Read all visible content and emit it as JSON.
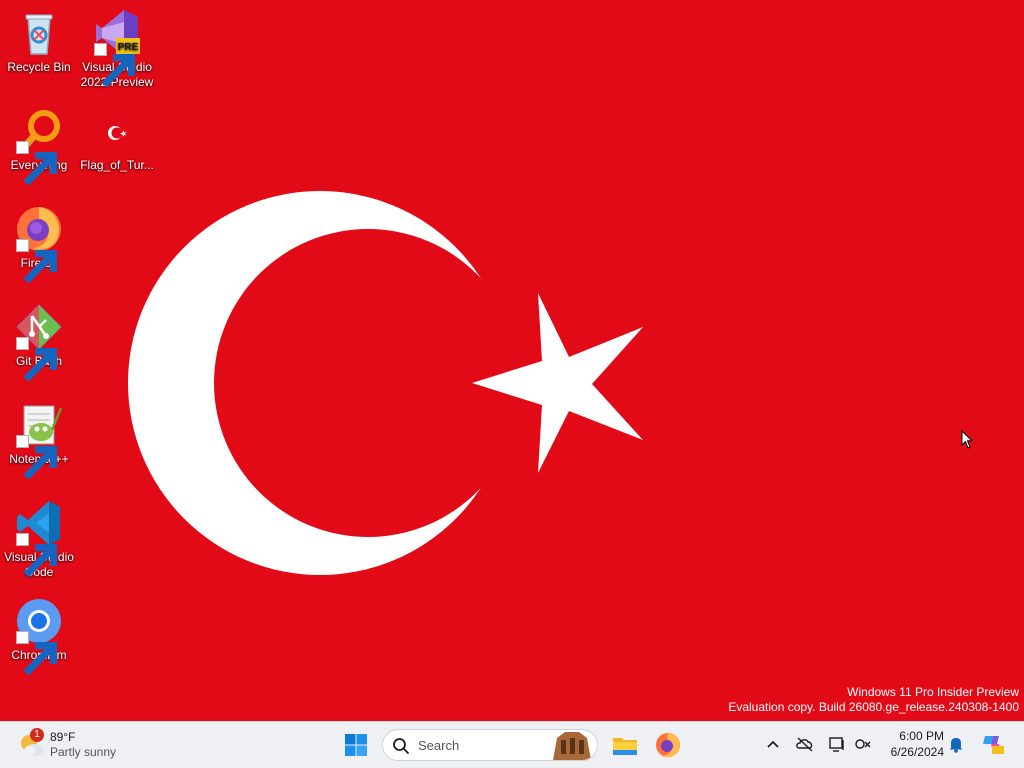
{
  "desktop": {
    "background_color": "#e30a17",
    "icons": [
      {
        "label": "Recycle Bin",
        "icon": "recycle-bin-icon"
      },
      {
        "label": "Visual Studio 2022 Preview",
        "icon": "visual-studio-preview-icon",
        "badge": "PRE"
      },
      {
        "label": "Everything",
        "icon": "everything-search-icon"
      },
      {
        "label": "Flag_of_Tur...",
        "icon": "turkey-flag-file-icon"
      },
      {
        "label": "Firefox",
        "icon": "firefox-icon"
      },
      {
        "label": "Git Bash",
        "icon": "git-bash-icon"
      },
      {
        "label": "Notepad++",
        "icon": "notepad-plus-plus-icon"
      },
      {
        "label": "Visual Studio Code",
        "icon": "vscode-icon"
      },
      {
        "label": "Chromium",
        "icon": "chromium-icon"
      }
    ],
    "watermark": {
      "line1": "Windows 11 Pro Insider Preview",
      "line2": "Evaluation copy. Build 26080.ge_release.240308-1400"
    }
  },
  "taskbar": {
    "weather": {
      "temperature": "89°F",
      "condition": "Partly sunny",
      "badge_count": "1"
    },
    "start_icon": "windows-start-icon",
    "search": {
      "placeholder": "Search"
    },
    "pinned": [
      {
        "name": "file-explorer-icon"
      },
      {
        "name": "firefox-icon"
      }
    ],
    "tray": {
      "icons": [
        "chevron-up-icon",
        "onedrive-offline-icon",
        "display-icon",
        "network-icon",
        "notification-bell-icon",
        "copilot-pre-icon"
      ],
      "time": "6:00 PM",
      "date": "6/26/2024"
    }
  }
}
